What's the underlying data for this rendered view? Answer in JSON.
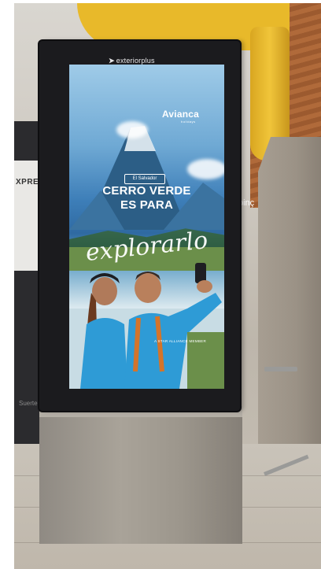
{
  "totem": {
    "brand": "exteriorplus"
  },
  "ad": {
    "airline_logo": "Avianca",
    "airline_subtitle": "holidays",
    "location_tag": "El Salvador",
    "headline_line1": "CERRO VERDE",
    "headline_line2": "ES PARA",
    "script_word": "explorarlo",
    "alliance_text": "A STAR ALLIANCE MEMBER"
  },
  "background": {
    "left_panel_text": "XPRESS",
    "left_bottom_text": "Suerte a condic",
    "right_sign_text": "oinç"
  },
  "colors": {
    "ceiling_yellow": "#e8b92a",
    "totem_frame": "#1b1b1e",
    "sky_blue": "#6fa9d4",
    "shirt_blue": "#2e9bd6"
  }
}
